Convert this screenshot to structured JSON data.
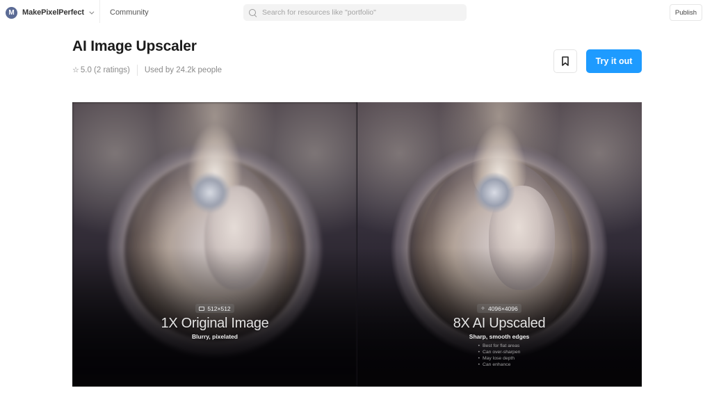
{
  "nav": {
    "avatar_letter": "M",
    "workspace_name": "MakePixelPerfect",
    "community_label": "Community",
    "search_placeholder": "Search for resources like \"portfolio\"",
    "search_value": "",
    "publish_label": "Publish"
  },
  "header": {
    "title": "AI Image Upscaler",
    "rating_icon": "star-outline-icon",
    "rating_text": "5.0 (2 ratings)",
    "usage_text": "Used by 24.2k people",
    "bookmark_icon": "bookmark-icon",
    "try_label": "Try it out",
    "accent_color": "#1e9bff"
  },
  "preview": {
    "left": {
      "resolution_icon": "image-size-icon",
      "resolution": "512×512",
      "title": "1X Original Image",
      "subtitle": "Blurry, pixelated"
    },
    "right": {
      "resolution_icon": "sparkle-icon",
      "resolution": "4096×4096",
      "title": "8X AI Upscaled",
      "subtitle": "Sharp, smooth edges",
      "bullets": [
        "Best for flat areas",
        "Can over-sharpen",
        "May lose depth",
        "Can enhance"
      ]
    }
  }
}
